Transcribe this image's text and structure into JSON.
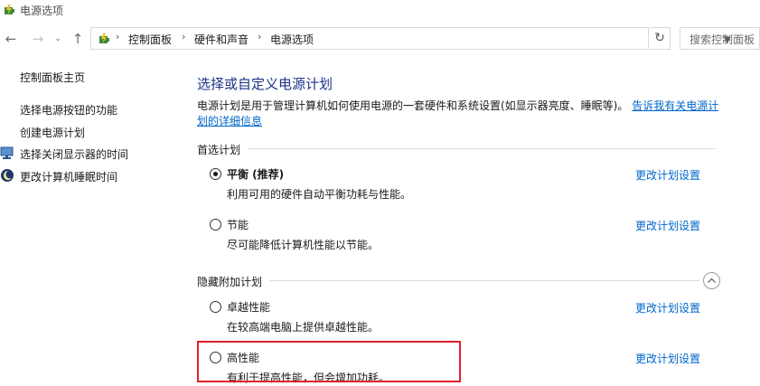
{
  "window": {
    "title": "电源选项"
  },
  "nav": {
    "back_icon": "arrow-left-icon",
    "forward_icon": "arrow-right-icon",
    "recent_icon": "chevron-down-icon",
    "up_icon": "arrow-up-icon",
    "breadcrumbs": [
      "控制面板",
      "硬件和声音",
      "电源选项"
    ],
    "search_placeholder": "搜索控制面板"
  },
  "sidebar": {
    "home_link": "控制面板主页",
    "items": [
      {
        "label": "选择电源按钮的功能",
        "icon": ""
      },
      {
        "label": "创建电源计划",
        "icon": ""
      },
      {
        "label": "选择关闭显示器的时间",
        "icon": "monitor-icon"
      },
      {
        "label": "更改计算机睡眠时间",
        "icon": "moon-icon"
      }
    ]
  },
  "main": {
    "title": "选择或自定义电源计划",
    "description": "电源计划是用于管理计算机如何使用电源的一套硬件和系统设置(如显示器亮度、睡眠等)。",
    "description_link": "告诉我有关电源计划的详细信息",
    "preferred_group": {
      "label": "首选计划",
      "plans": [
        {
          "name": "平衡 (推荐)",
          "desc": "利用可用的硬件自动平衡功耗与性能。",
          "selected": true,
          "link": "更改计划设置"
        },
        {
          "name": "节能",
          "desc": "尽可能降低计算机性能以节能。",
          "selected": false,
          "link": "更改计划设置"
        }
      ]
    },
    "hidden_group": {
      "label": "隐藏附加计划",
      "collapse_icon": "chevron-up-circle-icon",
      "plans": [
        {
          "name": "卓越性能",
          "desc": "在较高端电脑上提供卓越性能。",
          "selected": false,
          "link": "更改计划设置"
        },
        {
          "name": "高性能",
          "desc": "有利于提高性能，但会增加功耗。",
          "selected": false,
          "link": "更改计划设置"
        }
      ]
    }
  },
  "colors": {
    "title": "#1e3287",
    "link": "#0066cc",
    "highlight": "#e0202a"
  }
}
